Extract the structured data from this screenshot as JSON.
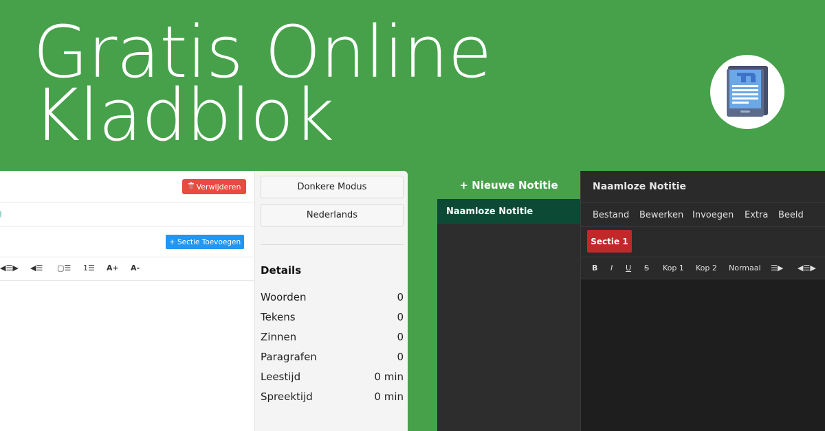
{
  "headline": {
    "line1": "Gratis Online",
    "line2": "Kladblok"
  },
  "colors": {
    "background": "#47a14a",
    "delete": "#e74c3c",
    "add_section": "#2196f3",
    "active_note": "#0d4a36",
    "section_tab": "#c0282a"
  },
  "logo": {
    "icon": "notepad-tablet-icon"
  },
  "light_editor": {
    "delete_label": "Verwijderen",
    "add_section_label": "+ Sectie Toevoegen",
    "toolbar": [
      "◀☰▶",
      "◀☰",
      "▢☰",
      "1☰",
      "A+",
      "A-"
    ],
    "sidebar": {
      "dark_mode_label": "Donkere Modus",
      "language_label": "Nederlands",
      "details_title": "Details",
      "stats": [
        {
          "label": "Woorden",
          "value": "0"
        },
        {
          "label": "Tekens",
          "value": "0"
        },
        {
          "label": "Zinnen",
          "value": "0"
        },
        {
          "label": "Paragrafen",
          "value": "0"
        },
        {
          "label": "Leestijd",
          "value": "0 min"
        },
        {
          "label": "Spreektijd",
          "value": "0 min"
        }
      ]
    }
  },
  "dark_editor": {
    "new_note_label": "+ Nieuwe Notitie",
    "active_note_label": "Naamloze Notitie",
    "title": "Naamloze Notitie",
    "menu": [
      "Bestand",
      "Bewerken",
      "Invoegen",
      "Extra",
      "Beeld"
    ],
    "section_label": "Sectie 1",
    "toolbar": [
      "B",
      "I",
      "U",
      "S",
      "Kop 1",
      "Kop 2",
      "Normaal",
      "☰▶",
      "◀☰▶"
    ]
  }
}
